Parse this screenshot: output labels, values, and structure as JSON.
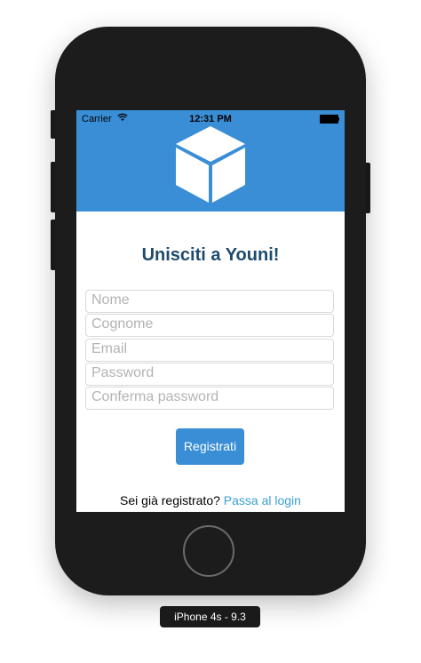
{
  "status_bar": {
    "carrier": "Carrier",
    "time": "12:31 PM",
    "icons": [
      "wifi-icon",
      "battery-icon"
    ]
  },
  "header": {
    "logo_icon": "cube-icon",
    "background_color": "#3a8ed6"
  },
  "form": {
    "title": "Unisciti a Youni!",
    "fields": [
      {
        "placeholder": "Nome",
        "value": ""
      },
      {
        "placeholder": "Cognome",
        "value": ""
      },
      {
        "placeholder": "Email",
        "value": ""
      },
      {
        "placeholder": "Password",
        "value": ""
      },
      {
        "placeholder": "Conferma password",
        "value": ""
      }
    ],
    "submit_label": "Registrati"
  },
  "footer": {
    "prompt": "Sei già registrato?",
    "link_label": "Passa al login"
  },
  "device": {
    "label": "iPhone 4s - 9.3"
  },
  "colors": {
    "accent": "#3a8ed6",
    "title": "#1f4b6e",
    "link": "#3aa0d6"
  }
}
